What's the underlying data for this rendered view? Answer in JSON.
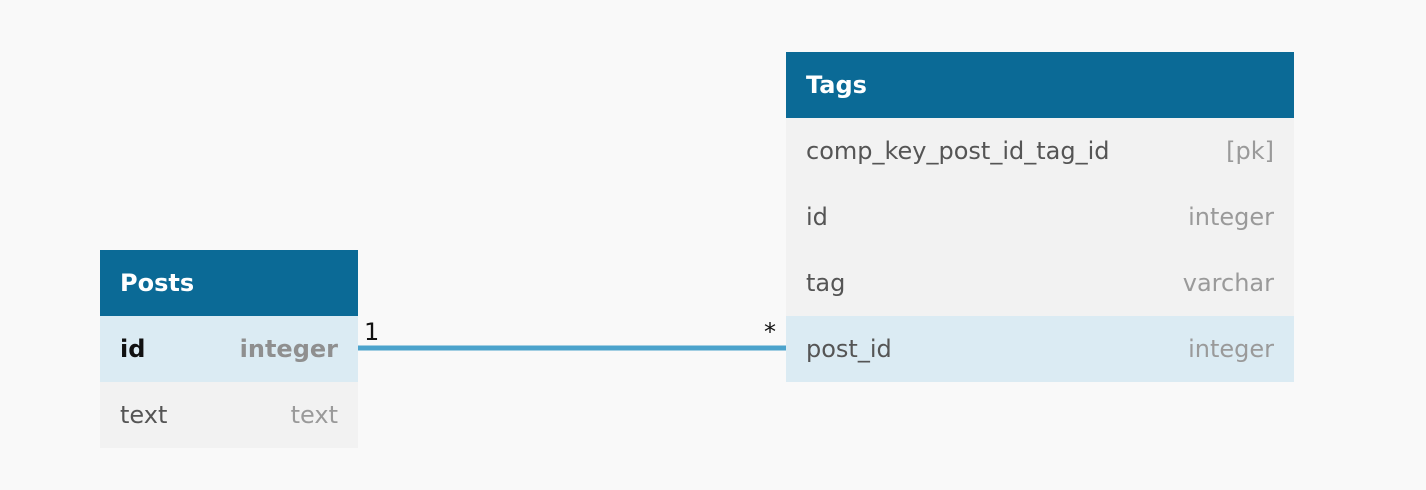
{
  "tables": {
    "posts": {
      "name": "Posts",
      "fields": [
        {
          "name": "id",
          "type": "integer"
        },
        {
          "name": "text",
          "type": "text"
        }
      ]
    },
    "tags": {
      "name": "Tags",
      "fields": [
        {
          "name": "comp_key_post_id_tag_id",
          "type": "[pk]"
        },
        {
          "name": "id",
          "type": "integer"
        },
        {
          "name": "tag",
          "type": "varchar"
        },
        {
          "name": "post_id",
          "type": "integer"
        }
      ]
    }
  },
  "relationship": {
    "from_cardinality": "1",
    "to_cardinality": "*"
  },
  "colors": {
    "header": "#0b6a96",
    "link": "#4ca3cc",
    "row_bg": "#f2f2f2",
    "row_highlight": "#dbebf3",
    "canvas_bg": "#f9f9f9"
  }
}
